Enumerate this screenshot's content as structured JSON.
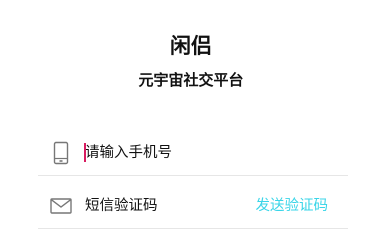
{
  "header": {
    "title": "闲侣",
    "subtitle": "元宇宙社交平台"
  },
  "phone_field": {
    "icon": "smartphone-icon",
    "placeholder": "请输入手机号",
    "value": ""
  },
  "sms_field": {
    "icon": "envelope-icon",
    "placeholder": "短信验证码",
    "value": "",
    "send_code_label": "发送验证码"
  },
  "colors": {
    "accent": "#3ad5e8",
    "caret": "#d81b60",
    "divider": "#e6e6e6",
    "icon": "#777777"
  }
}
